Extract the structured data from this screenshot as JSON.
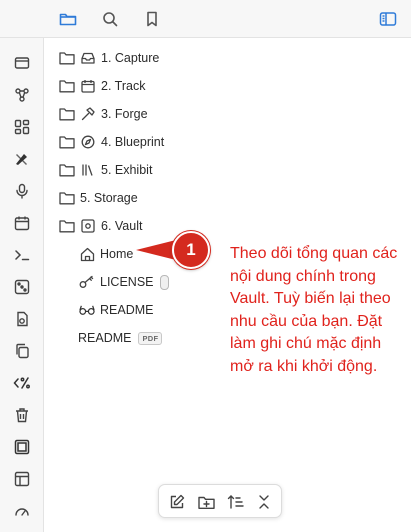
{
  "top_bar": {
    "icons": [
      "folder-icon",
      "search-icon",
      "bookmark-icon",
      "sidebar-toggle-icon"
    ],
    "accent": "#2f7bd8"
  },
  "ribbon": {
    "icons": [
      "tabs-icon",
      "graph-icon",
      "canvas-icon",
      "excalidraw-icon",
      "microphone-icon",
      "calendar-icon",
      "terminal-icon",
      "dice-icon",
      "import-icon",
      "copy-icon",
      "percent-icon",
      "trash-icon",
      "layers-icon",
      "template-icon",
      "gauge-icon"
    ]
  },
  "tree": {
    "folders": [
      {
        "name": "1. Capture",
        "icon": "inbox-icon"
      },
      {
        "name": "2. Track",
        "icon": "calendar-icon"
      },
      {
        "name": "3. Forge",
        "icon": "hammer-icon"
      },
      {
        "name": "4. Blueprint",
        "icon": "compass-icon"
      },
      {
        "name": "5. Exhibit",
        "icon": "library-icon"
      },
      {
        "name": "5. Storage",
        "icon": ""
      },
      {
        "name": "6. Vault",
        "icon": "safe-icon"
      }
    ],
    "children": [
      {
        "name": "Home",
        "icon": "home-icon"
      },
      {
        "name": "LICENSE",
        "icon": "key-icon"
      },
      {
        "name": "README",
        "icon": "glasses-icon"
      }
    ],
    "root_file": {
      "name": "README",
      "badge": "PDF"
    }
  },
  "callout": {
    "number": "1",
    "text": "Theo dõi tổng quan các nội dung chính trong Vault. Tuỳ biến lại theo nhu cầu của bạn. Đặt làm ghi chú mặc định mở ra khi khởi động.",
    "color": "#d42a1f"
  },
  "bottom_toolbar": {
    "icons": [
      "new-note-icon",
      "new-folder-icon",
      "sort-icon",
      "collapse-icon"
    ]
  }
}
